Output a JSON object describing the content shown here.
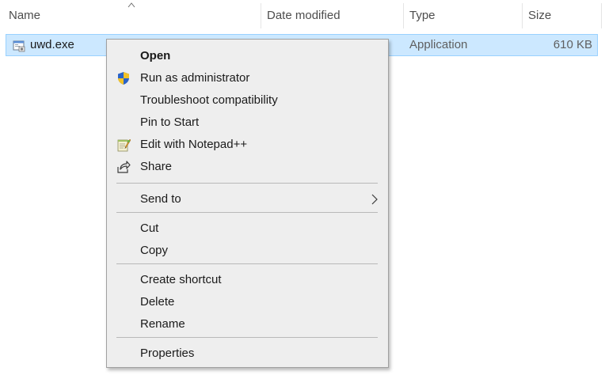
{
  "columns": {
    "name": "Name",
    "date_modified": "Date modified",
    "type": "Type",
    "size": "Size"
  },
  "file": {
    "name": "uwd.exe",
    "type": "Application",
    "size": "610 KB",
    "icon": "application-exe-icon"
  },
  "context_menu": {
    "open": "Open",
    "run_as_admin": "Run as administrator",
    "troubleshoot": "Troubleshoot compatibility",
    "pin_to_start": "Pin to Start",
    "edit_notepad": "Edit with Notepad++",
    "share": "Share",
    "send_to": "Send to",
    "cut": "Cut",
    "copy": "Copy",
    "create_shortcut": "Create shortcut",
    "delete": "Delete",
    "rename": "Rename",
    "properties": "Properties"
  },
  "colors": {
    "selection_bg": "#cce8ff",
    "selection_border": "#99d1ff",
    "menu_bg": "#eeeeee",
    "menu_border": "#a0a0a0",
    "separator": "#b8b8b8"
  }
}
